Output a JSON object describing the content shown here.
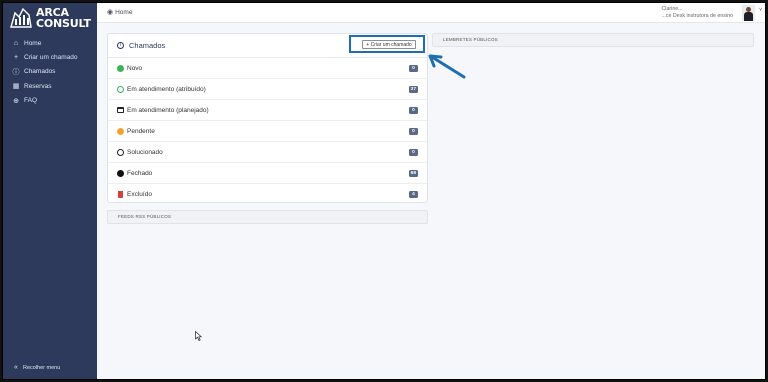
{
  "app": {
    "logo_line1": "ARCA",
    "logo_line2": "CONSULT"
  },
  "sidebar": {
    "items": [
      {
        "icon": "home-icon",
        "label": "Home"
      },
      {
        "icon": "plus-icon",
        "label": "Criar um chamado"
      },
      {
        "icon": "info-circle-icon",
        "label": "Chamados"
      },
      {
        "icon": "calendar-icon",
        "label": "Reservas"
      },
      {
        "icon": "help-icon",
        "label": "FAQ"
      }
    ],
    "collapse_label": "Recolher menu"
  },
  "topbar": {
    "breadcrumb": "Home",
    "user_name": "Clarine...",
    "user_role": "...ce Desk instrutora de ensino"
  },
  "tickets": {
    "title": "Chamados",
    "new_button": "+ Criar um chamado",
    "rows": [
      {
        "status": "new",
        "label": "Novo",
        "count": "0"
      },
      {
        "status": "assigned",
        "label": "Em atendimento (atribuído)",
        "count": "37"
      },
      {
        "status": "planned",
        "label": "Em atendimento (planejado)",
        "count": "0"
      },
      {
        "status": "pending",
        "label": "Pendente",
        "count": "0"
      },
      {
        "status": "solved",
        "label": "Solucionado",
        "count": "0"
      },
      {
        "status": "closed",
        "label": "Fechado",
        "count": "68"
      },
      {
        "status": "deleted",
        "label": "Excluído",
        "count": "4"
      }
    ]
  },
  "panels": {
    "feeds": "FEEDS RSS PÚBLICOS",
    "reminders": "LEMBRETES PÚBLICOS"
  },
  "colors": {
    "sidebar_bg": "#2d3a5c",
    "highlight": "#1f6fb0",
    "new_status": "#3cb35b",
    "pending_status": "#f3a62e",
    "deleted_status": "#d43f3a"
  }
}
